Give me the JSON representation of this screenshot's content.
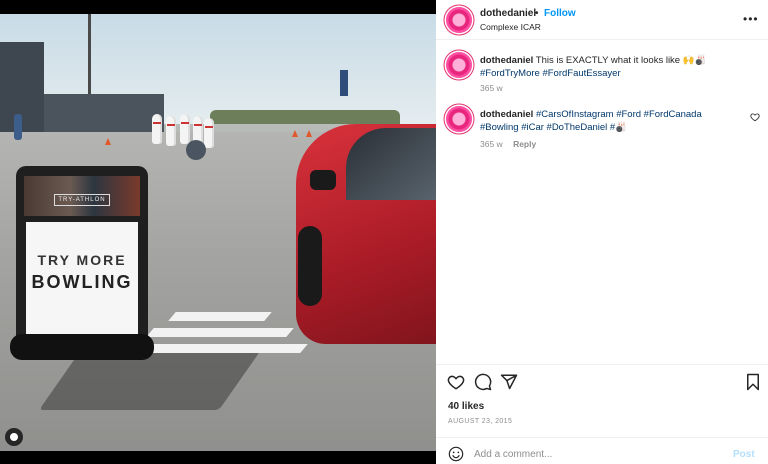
{
  "header": {
    "username": "dothedaniel",
    "separator": "•",
    "follow_label": "Follow",
    "location": "Complexe ICAR",
    "more_icon": "more-horizontal-icon"
  },
  "media": {
    "sign_brand": "TRY-ATHLON",
    "sign_line1": "TRY MORE",
    "sign_line2": "BOWLING",
    "user_tag_icon": "user-tag-icon"
  },
  "comments": [
    {
      "username": "dothedaniel",
      "text": "This is EXACTLY what it looks like 🙌🎳",
      "hashtags": "#FordTryMore #FordFautEssayer",
      "time": "365 w",
      "reply_label": ""
    },
    {
      "username": "dothedaniel",
      "text": "",
      "hashtags": "#CarsOfInstagram #Ford #FordCanada #Bowling #iCar #DoTheDaniel #🎳",
      "time": "365 w",
      "reply_label": "Reply"
    }
  ],
  "actions": {
    "like_icon": "heart-icon",
    "comment_icon": "comment-icon",
    "share_icon": "share-icon",
    "save_icon": "bookmark-icon"
  },
  "likes": "40 likes",
  "date": "AUGUST 23, 2015",
  "add_comment": {
    "placeholder": "Add a comment...",
    "post_label": "Post",
    "emoji_icon": "smiley-icon"
  },
  "colors": {
    "follow_blue": "#0095f6",
    "hashtag": "#00376b",
    "post_disabled": "#b2dffc",
    "avatar_pink": "#e8267d"
  }
}
